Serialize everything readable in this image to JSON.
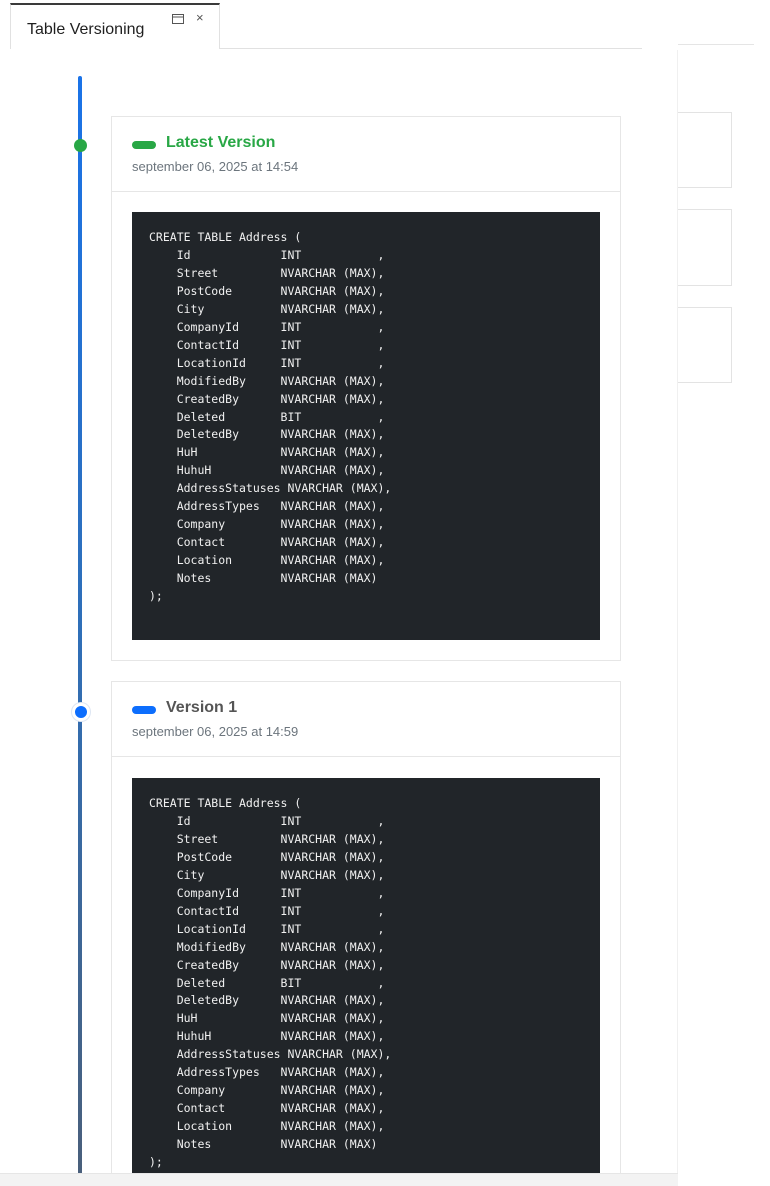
{
  "tab": {
    "label": "Table Versioning",
    "restore_icon": "restore-window-icon",
    "close_glyph": "×"
  },
  "versions": [
    {
      "title": "Latest Version",
      "date": "september 06, 2025 at 14:54",
      "accent": "#28a745",
      "code": "CREATE TABLE Address (\n    Id             INT           ,\n    Street         NVARCHAR (MAX),\n    PostCode       NVARCHAR (MAX),\n    City           NVARCHAR (MAX),\n    CompanyId      INT           ,\n    ContactId      INT           ,\n    LocationId     INT           ,\n    ModifiedBy     NVARCHAR (MAX),\n    CreatedBy      NVARCHAR (MAX),\n    Deleted        BIT           ,\n    DeletedBy      NVARCHAR (MAX),\n    HuH            NVARCHAR (MAX),\n    HuhuH          NVARCHAR (MAX),\n    AddressStatuses NVARCHAR (MAX),\n    AddressTypes   NVARCHAR (MAX),\n    Company        NVARCHAR (MAX),\n    Contact        NVARCHAR (MAX),\n    Location       NVARCHAR (MAX),\n    Notes          NVARCHAR (MAX)\n);"
    },
    {
      "title": "Version 1",
      "date": "september 06, 2025 at 14:59",
      "accent": "#0d6efd",
      "code": "CREATE TABLE Address (\n    Id             INT           ,\n    Street         NVARCHAR (MAX),\n    PostCode       NVARCHAR (MAX),\n    City           NVARCHAR (MAX),\n    CompanyId      INT           ,\n    ContactId      INT           ,\n    LocationId     INT           ,\n    ModifiedBy     NVARCHAR (MAX),\n    CreatedBy      NVARCHAR (MAX),\n    Deleted        BIT           ,\n    DeletedBy      NVARCHAR (MAX),\n    HuH            NVARCHAR (MAX),\n    HuhuH          NVARCHAR (MAX),\n    AddressStatuses NVARCHAR (MAX),\n    AddressTypes   NVARCHAR (MAX),\n    Company        NVARCHAR (MAX),\n    Contact        NVARCHAR (MAX),\n    Location       NVARCHAR (MAX),\n    Notes          NVARCHAR (MAX)\n);"
    }
  ],
  "colors": {
    "timeline": "#1a73e8",
    "code_background": "#212529"
  }
}
